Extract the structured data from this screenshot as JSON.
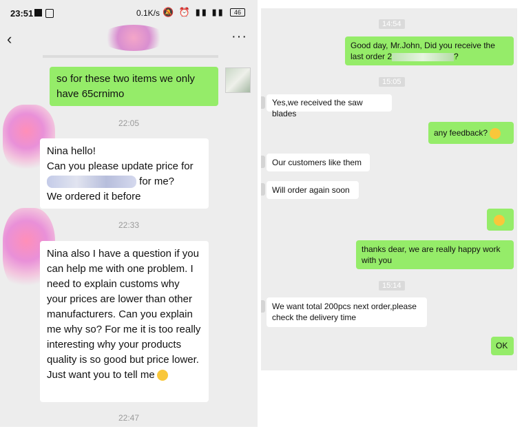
{
  "left_phone": {
    "status_bar": {
      "time": "23:51",
      "network_speed": "0.1K/s",
      "icons": "🔕 ⏰ ▮▮ ▮▮",
      "battery": "46"
    },
    "nav": {
      "back_icon": "‹",
      "more_icon": "···"
    },
    "messages": [
      {
        "text": "so for these two items we only have 65crnimo"
      },
      {
        "time": "22:05"
      },
      {
        "line1": "Nina hello!",
        "line2": "Can you please update price for",
        "line3_after": " for me?",
        "line4": "We ordered it before"
      },
      {
        "time": "22:33"
      },
      {
        "text": "Nina also I have a question if you can help me with one problem. I need to explain customs why your prices are lower than other manufacturers. Can you explain me why so? For me it is too really interesting why your products quality is so good but price lower. Just want you to tell me"
      },
      {
        "time": "22:47"
      }
    ]
  },
  "right_chat": {
    "messages": [
      {
        "time": "14:54"
      },
      {
        "text_before": "Good day, Mr.John, Did you receive the last order 2",
        "text_after": "?"
      },
      {
        "time": "15:05"
      },
      {
        "text": "Yes,we received the saw blades"
      },
      {
        "text": "any feedback?"
      },
      {
        "text": "Our customers like them"
      },
      {
        "text": "Will order again soon"
      },
      {
        "text": ""
      },
      {
        "text": "thanks dear, we are really happy work with you"
      },
      {
        "time": "15:14"
      },
      {
        "text": "We want total 200pcs next order,please check the delivery time"
      },
      {
        "text": "OK"
      }
    ]
  },
  "colors": {
    "sent_bubble": "#95ec69",
    "received_bubble": "#ffffff",
    "chat_background": "#ededed"
  }
}
